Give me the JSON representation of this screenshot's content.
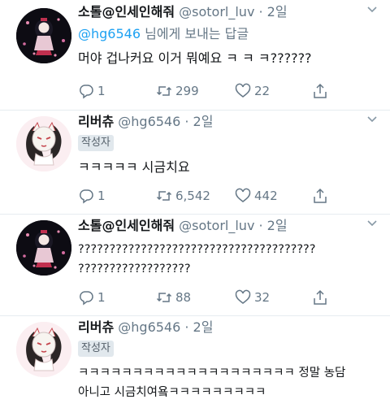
{
  "tweets": [
    {
      "name": "소톨@인세인해줘",
      "handle": "@sotorl_luv",
      "time": "· 2일",
      "reply_prefix": "",
      "reply_user": "@hg6546",
      "reply_suffix": " 님에게 보내는 답글",
      "badge": "",
      "text": "머야 겁나커요 이거 뭐예요 ㅋ ㅋ ㅋ??????",
      "replies": "1",
      "retweets": "299",
      "likes": "22"
    },
    {
      "name": "리버츄",
      "handle": "@hg6546",
      "time": "· 2일",
      "badge": "작성자",
      "text": "ㅋㅋㅋㅋㅋ 시금치요",
      "replies": "1",
      "retweets": "6,542",
      "likes": "442"
    },
    {
      "name": "소톨@인세인해줘",
      "handle": "@sotorl_luv",
      "time": "· 2일",
      "badge": "",
      "text": "??????????????????????????????????????\n??????????????????",
      "replies": "1",
      "retweets": "88",
      "likes": "32"
    },
    {
      "name": "리버츄",
      "handle": "@hg6546",
      "time": "· 2일",
      "badge": "작성자",
      "text": "ㅋㅋㅋㅋㅋㅋㅋㅋㅋㅋㅋㅋㅋㅋㅋㅋㅋㅋㅋㅋ 정말 농담\n아니고 시금치여욬ㅋㅋㅋㅋㅋㅋㅋㅋㅋ"
    }
  ],
  "icons": {
    "reply": "reply-icon",
    "retweet": "retweet-icon",
    "like": "heart-icon",
    "share": "share-icon",
    "more": "chevron-down-icon"
  },
  "colors": {
    "name": "#14171a",
    "meta": "#657786",
    "mention": "#1da1f2",
    "divider": "#e6ecf0",
    "badge_bg": "#e1e8ed"
  }
}
